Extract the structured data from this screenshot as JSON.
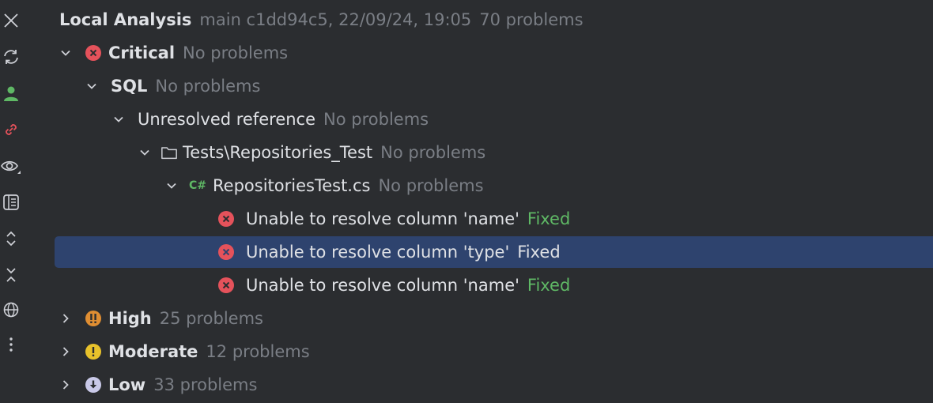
{
  "header": {
    "title": "Local Analysis",
    "meta": "main c1dd94c5, 22/09/24, 19:05",
    "count": "70 problems"
  },
  "toolstrip": [
    {
      "icon": "close-icon"
    },
    {
      "icon": "refresh-icon"
    },
    {
      "icon": "user-icon"
    },
    {
      "icon": "link-icon"
    },
    {
      "icon": "eye-icon"
    },
    {
      "icon": "preview-icon"
    },
    {
      "icon": "expand-all-icon"
    },
    {
      "icon": "collapse-all-icon"
    },
    {
      "icon": "globe-icon"
    },
    {
      "icon": "more-icon"
    }
  ],
  "tree": {
    "critical": {
      "label": "Critical",
      "status": "No problems"
    },
    "sql": {
      "label": "SQL",
      "status": "No problems"
    },
    "unresolved": {
      "label": "Unresolved reference",
      "status": "No problems"
    },
    "folder": {
      "label": "Tests\\Repositories_Test",
      "status": "No problems"
    },
    "file": {
      "badge": "C#",
      "label": "RepositoriesTest.cs",
      "status": "No problems"
    },
    "issues": [
      {
        "label": "Unable to resolve column 'name'",
        "status": "Fixed"
      },
      {
        "label": "Unable to resolve column 'type'",
        "status": "Fixed"
      },
      {
        "label": "Unable to resolve column 'name'",
        "status": "Fixed"
      }
    ],
    "high": {
      "label": "High",
      "status": "25 problems"
    },
    "moderate": {
      "label": "Moderate",
      "status": "12 problems"
    },
    "low": {
      "label": "Low",
      "status": "33 problems"
    }
  },
  "colors": {
    "background": "#2b2d30",
    "selection": "#2e436e",
    "error": "#e5525b",
    "high": "#e08e32",
    "moderate": "#e8c22b",
    "low": "#c9c9e8",
    "fixed": "#5fb865",
    "muted": "#7a7e85"
  }
}
